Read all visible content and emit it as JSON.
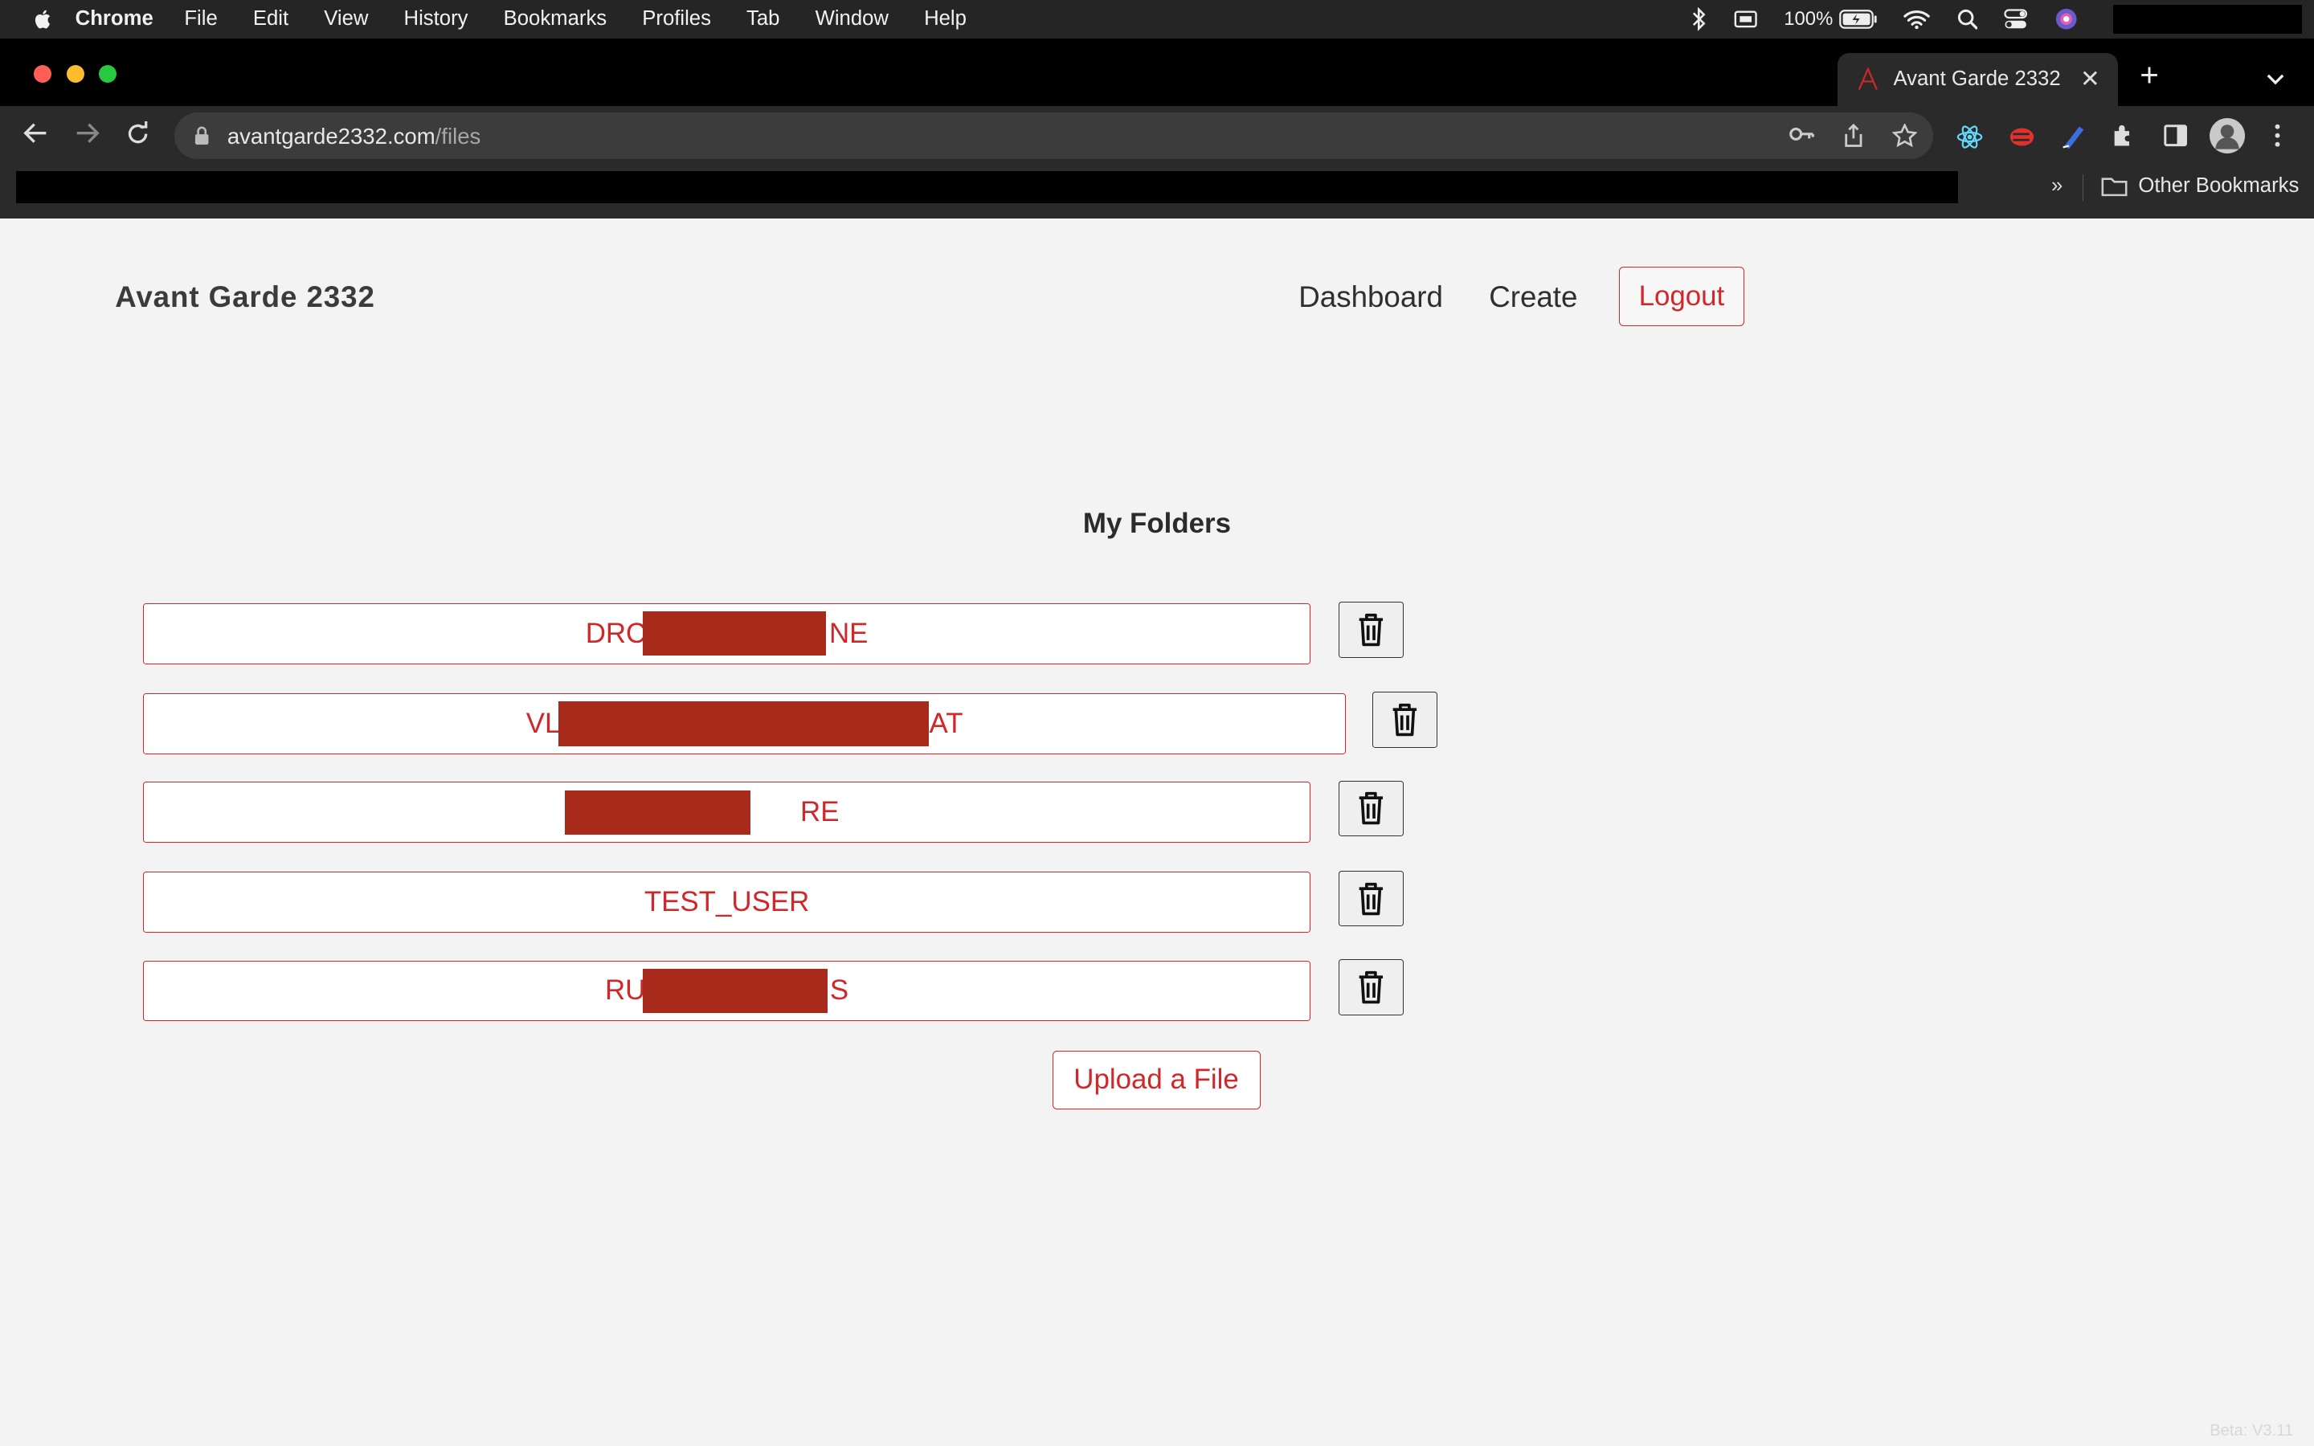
{
  "menubar": {
    "app_name": "Chrome",
    "items": [
      "File",
      "Edit",
      "View",
      "History",
      "Bookmarks",
      "Profiles",
      "Tab",
      "Window",
      "Help"
    ],
    "battery": "100%"
  },
  "browser": {
    "tab_title": "Avant Garde 2332",
    "url_domain": "avantgarde2332.com",
    "url_path": "/files",
    "other_bookmarks": "Other Bookmarks",
    "bookmarks_overflow": "»"
  },
  "site": {
    "title": "Avant Garde 2332",
    "nav": {
      "dashboard": "Dashboard",
      "create": "Create",
      "logout": "Logout"
    }
  },
  "main": {
    "heading": "My Folders",
    "folders": [
      {
        "prefix": "DRC",
        "suffix": "NE"
      },
      {
        "prefix": "VL",
        "suffix": "AT"
      },
      {
        "prefix": "",
        "suffix": "RE"
      },
      {
        "prefix": "TEST_USER",
        "suffix": ""
      },
      {
        "prefix": "RU",
        "suffix": "S"
      }
    ],
    "upload_button": "Upload a File"
  },
  "footer": {
    "version": "Beta: V3.11"
  },
  "colors": {
    "accent": "#d0282a",
    "redaction": "#a82a1a",
    "background": "#f3f3f3"
  }
}
